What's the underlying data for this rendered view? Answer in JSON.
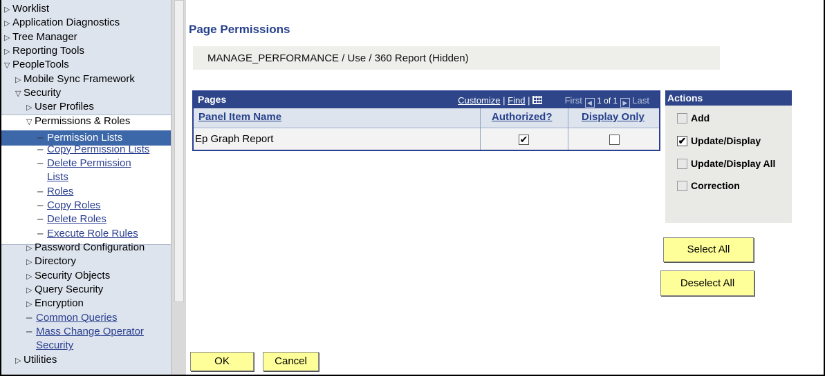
{
  "nav": {
    "items": [
      {
        "label": "Worklist",
        "kind": "collapsed",
        "indent": 0
      },
      {
        "label": "Application Diagnostics",
        "kind": "collapsed",
        "indent": 0
      },
      {
        "label": "Tree Manager",
        "kind": "collapsed",
        "indent": 0
      },
      {
        "label": "Reporting Tools",
        "kind": "collapsed",
        "indent": 0
      },
      {
        "label": "PeopleTools",
        "kind": "expanded",
        "indent": 0
      },
      {
        "label": "Mobile Sync Framework",
        "kind": "collapsed",
        "indent": 1
      },
      {
        "label": "Security",
        "kind": "expanded",
        "indent": 1
      },
      {
        "label": "User Profiles",
        "kind": "collapsed",
        "indent": 2
      },
      {
        "label": "Permissions & Roles",
        "kind": "expanded",
        "indent": 2
      },
      {
        "label": "Permission Lists",
        "kind": "selected",
        "indent": 3
      },
      {
        "label": "Copy Permission Lists",
        "kind": "link",
        "indent": 3
      },
      {
        "label": "Delete Permission",
        "kind": "link",
        "indent": 3
      },
      {
        "label": "Lists",
        "kind": "link-cont",
        "indent": 3
      },
      {
        "label": "Roles",
        "kind": "link",
        "indent": 3
      },
      {
        "label": "Copy Roles",
        "kind": "link",
        "indent": 3
      },
      {
        "label": "Delete Roles",
        "kind": "link",
        "indent": 3
      },
      {
        "label": "Execute Role Rules",
        "kind": "link",
        "indent": 3
      },
      {
        "label": "Password Configuration",
        "kind": "collapsed",
        "indent": 2
      },
      {
        "label": "Directory",
        "kind": "collapsed",
        "indent": 2
      },
      {
        "label": "Security Objects",
        "kind": "collapsed",
        "indent": 2
      },
      {
        "label": "Query Security",
        "kind": "collapsed",
        "indent": 2
      },
      {
        "label": "Encryption",
        "kind": "collapsed",
        "indent": 2
      },
      {
        "label": "Common Queries",
        "kind": "link",
        "indent": 2
      },
      {
        "label": "Mass Change Operator",
        "kind": "link",
        "indent": 2
      },
      {
        "label": "Security",
        "kind": "link-cont",
        "indent": 2
      },
      {
        "label": "Utilities",
        "kind": "collapsed",
        "indent": 1
      }
    ]
  },
  "page": {
    "title": "Page Permissions",
    "path": "MANAGE_PERFORMANCE / Use / 360 Report (Hidden)"
  },
  "grid": {
    "title": "Pages",
    "customize": "Customize",
    "find": "Find",
    "first": "First",
    "range": "1 of 1",
    "last": "Last",
    "columns": {
      "name": "Panel Item Name",
      "authorized": "Authorized?",
      "display_only": "Display Only"
    },
    "rows": [
      {
        "name": "Ep Graph Report",
        "authorized": true,
        "display_only": false
      }
    ]
  },
  "actions": {
    "title": "Actions",
    "items": [
      {
        "label": "Add",
        "checked": false
      },
      {
        "label": "Update/Display",
        "checked": true
      },
      {
        "label": "Update/Display All",
        "checked": false
      },
      {
        "label": "Correction",
        "checked": false
      }
    ],
    "select_all": "Select All",
    "deselect_all": "Deselect All"
  },
  "footer": {
    "ok": "OK",
    "cancel": "Cancel"
  },
  "colors": {
    "header_blue": "#2e4689",
    "title_blue": "#27408b",
    "selected_nav": "#3c67a8",
    "button_yellow": "#ffff99"
  }
}
